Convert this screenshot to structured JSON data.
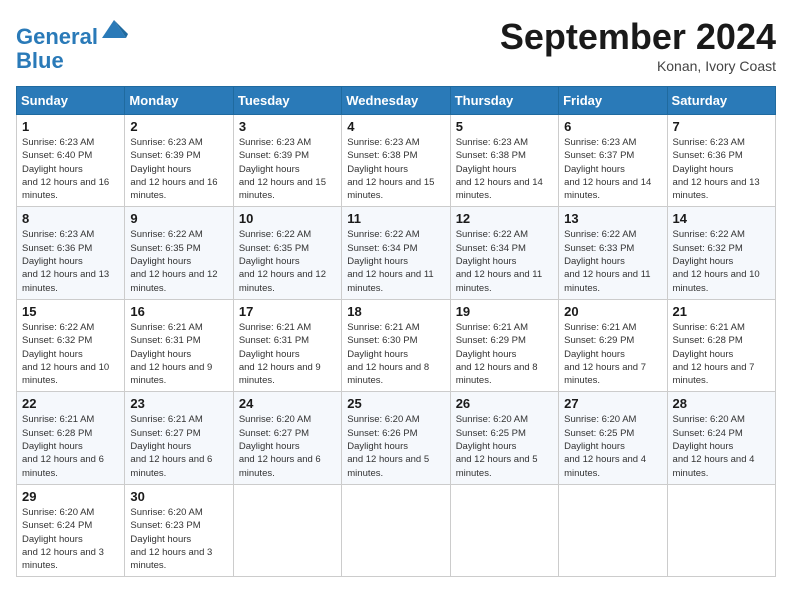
{
  "header": {
    "logo_line1": "General",
    "logo_line2": "Blue",
    "month": "September 2024",
    "location": "Konan, Ivory Coast"
  },
  "weekdays": [
    "Sunday",
    "Monday",
    "Tuesday",
    "Wednesday",
    "Thursday",
    "Friday",
    "Saturday"
  ],
  "weeks": [
    [
      {
        "day": "1",
        "rise": "6:23 AM",
        "set": "6:40 PM",
        "hours": "12 hours and 16 minutes."
      },
      {
        "day": "2",
        "rise": "6:23 AM",
        "set": "6:39 PM",
        "hours": "12 hours and 16 minutes."
      },
      {
        "day": "3",
        "rise": "6:23 AM",
        "set": "6:39 PM",
        "hours": "12 hours and 15 minutes."
      },
      {
        "day": "4",
        "rise": "6:23 AM",
        "set": "6:38 PM",
        "hours": "12 hours and 15 minutes."
      },
      {
        "day": "5",
        "rise": "6:23 AM",
        "set": "6:38 PM",
        "hours": "12 hours and 14 minutes."
      },
      {
        "day": "6",
        "rise": "6:23 AM",
        "set": "6:37 PM",
        "hours": "12 hours and 14 minutes."
      },
      {
        "day": "7",
        "rise": "6:23 AM",
        "set": "6:36 PM",
        "hours": "12 hours and 13 minutes."
      }
    ],
    [
      {
        "day": "8",
        "rise": "6:23 AM",
        "set": "6:36 PM",
        "hours": "12 hours and 13 minutes."
      },
      {
        "day": "9",
        "rise": "6:22 AM",
        "set": "6:35 PM",
        "hours": "12 hours and 12 minutes."
      },
      {
        "day": "10",
        "rise": "6:22 AM",
        "set": "6:35 PM",
        "hours": "12 hours and 12 minutes."
      },
      {
        "day": "11",
        "rise": "6:22 AM",
        "set": "6:34 PM",
        "hours": "12 hours and 11 minutes."
      },
      {
        "day": "12",
        "rise": "6:22 AM",
        "set": "6:34 PM",
        "hours": "12 hours and 11 minutes."
      },
      {
        "day": "13",
        "rise": "6:22 AM",
        "set": "6:33 PM",
        "hours": "12 hours and 11 minutes."
      },
      {
        "day": "14",
        "rise": "6:22 AM",
        "set": "6:32 PM",
        "hours": "12 hours and 10 minutes."
      }
    ],
    [
      {
        "day": "15",
        "rise": "6:22 AM",
        "set": "6:32 PM",
        "hours": "12 hours and 10 minutes."
      },
      {
        "day": "16",
        "rise": "6:21 AM",
        "set": "6:31 PM",
        "hours": "12 hours and 9 minutes."
      },
      {
        "day": "17",
        "rise": "6:21 AM",
        "set": "6:31 PM",
        "hours": "12 hours and 9 minutes."
      },
      {
        "day": "18",
        "rise": "6:21 AM",
        "set": "6:30 PM",
        "hours": "12 hours and 8 minutes."
      },
      {
        "day": "19",
        "rise": "6:21 AM",
        "set": "6:29 PM",
        "hours": "12 hours and 8 minutes."
      },
      {
        "day": "20",
        "rise": "6:21 AM",
        "set": "6:29 PM",
        "hours": "12 hours and 7 minutes."
      },
      {
        "day": "21",
        "rise": "6:21 AM",
        "set": "6:28 PM",
        "hours": "12 hours and 7 minutes."
      }
    ],
    [
      {
        "day": "22",
        "rise": "6:21 AM",
        "set": "6:28 PM",
        "hours": "12 hours and 6 minutes."
      },
      {
        "day": "23",
        "rise": "6:21 AM",
        "set": "6:27 PM",
        "hours": "12 hours and 6 minutes."
      },
      {
        "day": "24",
        "rise": "6:20 AM",
        "set": "6:27 PM",
        "hours": "12 hours and 6 minutes."
      },
      {
        "day": "25",
        "rise": "6:20 AM",
        "set": "6:26 PM",
        "hours": "12 hours and 5 minutes."
      },
      {
        "day": "26",
        "rise": "6:20 AM",
        "set": "6:25 PM",
        "hours": "12 hours and 5 minutes."
      },
      {
        "day": "27",
        "rise": "6:20 AM",
        "set": "6:25 PM",
        "hours": "12 hours and 4 minutes."
      },
      {
        "day": "28",
        "rise": "6:20 AM",
        "set": "6:24 PM",
        "hours": "12 hours and 4 minutes."
      }
    ],
    [
      {
        "day": "29",
        "rise": "6:20 AM",
        "set": "6:24 PM",
        "hours": "12 hours and 3 minutes."
      },
      {
        "day": "30",
        "rise": "6:20 AM",
        "set": "6:23 PM",
        "hours": "12 hours and 3 minutes."
      },
      null,
      null,
      null,
      null,
      null
    ]
  ]
}
